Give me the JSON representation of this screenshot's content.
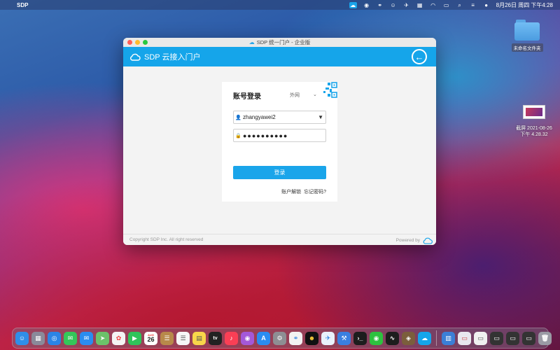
{
  "menubar": {
    "app_name": "SDP",
    "clock": "8月26日 周四 下午4:28"
  },
  "desktop": {
    "folder_label": "未命名文件夹",
    "screenshot_label_line1": "截屏 2021-08-26",
    "screenshot_label_line2": "下午 4.28.32"
  },
  "window": {
    "title": "SDP 统一门户 - 企业版",
    "brand": "SDP 云接入门户",
    "login": {
      "title": "账号登录",
      "network": "外网",
      "username": "zhangyawei2",
      "password_mask": "●●●●●●●●●●",
      "login_button": "登录",
      "unlock_link": "账户解锁",
      "forgot_link": "忘记密码?"
    },
    "footer": {
      "copyright": "Copyright SDP Inc.  All  right reserved",
      "powered_by": "Powered by"
    }
  },
  "dock": {
    "calendar_month": "AUG",
    "calendar_day": "26",
    "tv_label": "tv"
  },
  "colors": {
    "accent": "#15a5ea",
    "login_button": "#1aa5ea"
  }
}
